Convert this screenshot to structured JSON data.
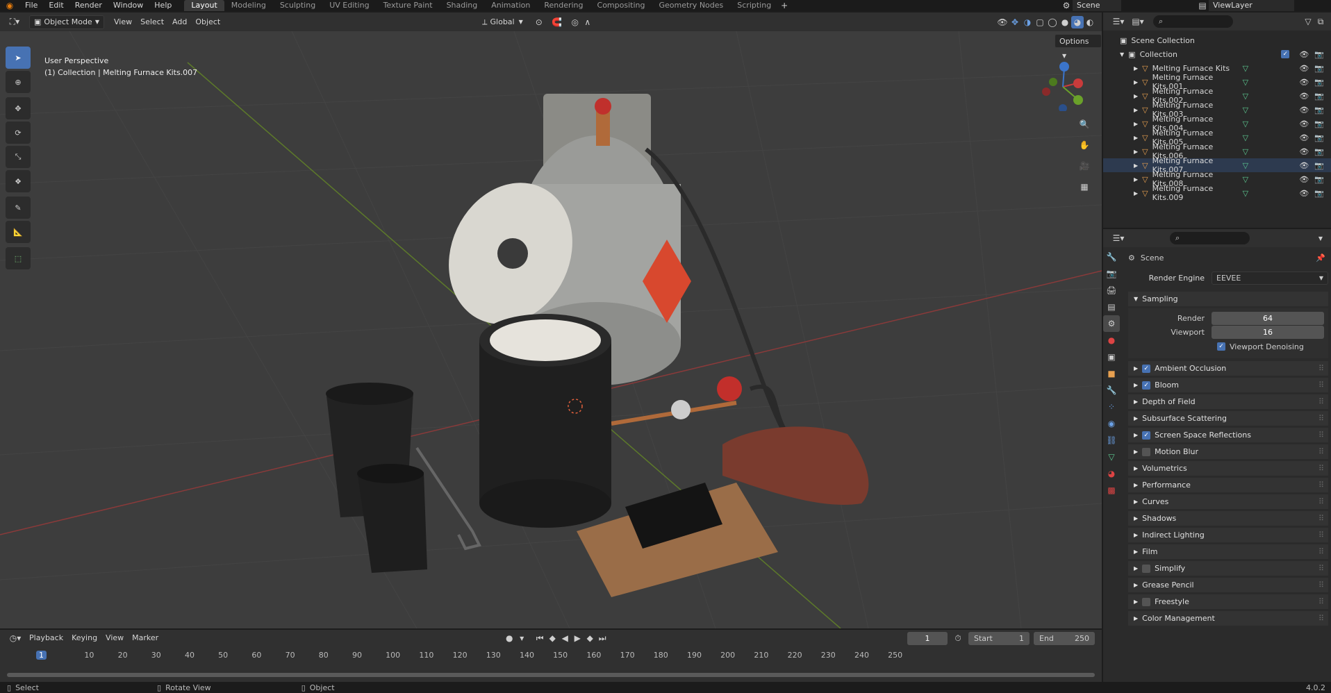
{
  "menu": [
    "File",
    "Edit",
    "Render",
    "Window",
    "Help"
  ],
  "workspaces": [
    "Layout",
    "Modeling",
    "Sculpting",
    "UV Editing",
    "Texture Paint",
    "Shading",
    "Animation",
    "Rendering",
    "Compositing",
    "Geometry Nodes",
    "Scripting"
  ],
  "active_workspace": "Layout",
  "scene_name": "Scene",
  "view_layer": "ViewLayer",
  "viewport_header": {
    "mode": "Object Mode",
    "menus": [
      "View",
      "Select",
      "Add",
      "Object"
    ],
    "transform_orientation": "Global",
    "options": "Options"
  },
  "viewport": {
    "perspective": "User Perspective",
    "collection_info": "(1) Collection | Melting Furnace Kits.007",
    "gizmo_axes": [
      "X",
      "Y",
      "Z"
    ]
  },
  "outliner": {
    "root": "Scene Collection",
    "collection": "Collection",
    "items": [
      "Melting Furnace Kits",
      "Melting Furnace Kits.001",
      "Melting Furnace Kits.002",
      "Melting Furnace Kits.003",
      "Melting Furnace Kits.004",
      "Melting Furnace Kits.005",
      "Melting Furnace Kits.006",
      "Melting Furnace Kits.007",
      "Melting Furnace Kits.008",
      "Melting Furnace Kits.009"
    ],
    "selected": "Melting Furnace Kits.007"
  },
  "properties": {
    "context": "Scene",
    "render_engine_label": "Render Engine",
    "render_engine": "EEVEE",
    "sampling": {
      "title": "Sampling",
      "render_label": "Render",
      "render": "64",
      "viewport_label": "Viewport",
      "viewport": "16",
      "denoise": "Viewport Denoising"
    },
    "panels": [
      {
        "label": "Ambient Occlusion",
        "checkbox": true,
        "checked": true
      },
      {
        "label": "Bloom",
        "checkbox": true,
        "checked": true
      },
      {
        "label": "Depth of Field",
        "checkbox": false,
        "checked": false
      },
      {
        "label": "Subsurface Scattering",
        "checkbox": false,
        "checked": false
      },
      {
        "label": "Screen Space Reflections",
        "checkbox": true,
        "checked": true
      },
      {
        "label": "Motion Blur",
        "checkbox": true,
        "checked": false
      },
      {
        "label": "Volumetrics",
        "checkbox": false,
        "checked": false
      },
      {
        "label": "Performance",
        "checkbox": false,
        "checked": false
      },
      {
        "label": "Curves",
        "checkbox": false,
        "checked": false
      },
      {
        "label": "Shadows",
        "checkbox": false,
        "checked": false
      },
      {
        "label": "Indirect Lighting",
        "checkbox": false,
        "checked": false
      },
      {
        "label": "Film",
        "checkbox": false,
        "checked": false
      },
      {
        "label": "Simplify",
        "checkbox": true,
        "checked": false
      },
      {
        "label": "Grease Pencil",
        "checkbox": false,
        "checked": false
      },
      {
        "label": "Freestyle",
        "checkbox": true,
        "checked": false
      },
      {
        "label": "Color Management",
        "checkbox": false,
        "checked": false
      }
    ]
  },
  "timeline": {
    "menus": [
      "Playback",
      "Keying",
      "View",
      "Marker"
    ],
    "current_frame": "1",
    "start_label": "Start",
    "start": "1",
    "end_label": "End",
    "end": "250",
    "ticks": [
      "1",
      "10",
      "20",
      "30",
      "40",
      "50",
      "60",
      "70",
      "80",
      "90",
      "100",
      "110",
      "120",
      "130",
      "140",
      "150",
      "160",
      "170",
      "180",
      "190",
      "200",
      "210",
      "220",
      "230",
      "240",
      "250"
    ]
  },
  "statusbar": {
    "select": "Select",
    "rotate": "Rotate View",
    "object": "Object",
    "version": "4.0.2"
  },
  "colors": {
    "accent": "#4772b3",
    "mesh_icon": "#e8a050",
    "data_icon": "#5dc891",
    "axis_x": "#c93b3b",
    "axis_y": "#6aa12a"
  }
}
